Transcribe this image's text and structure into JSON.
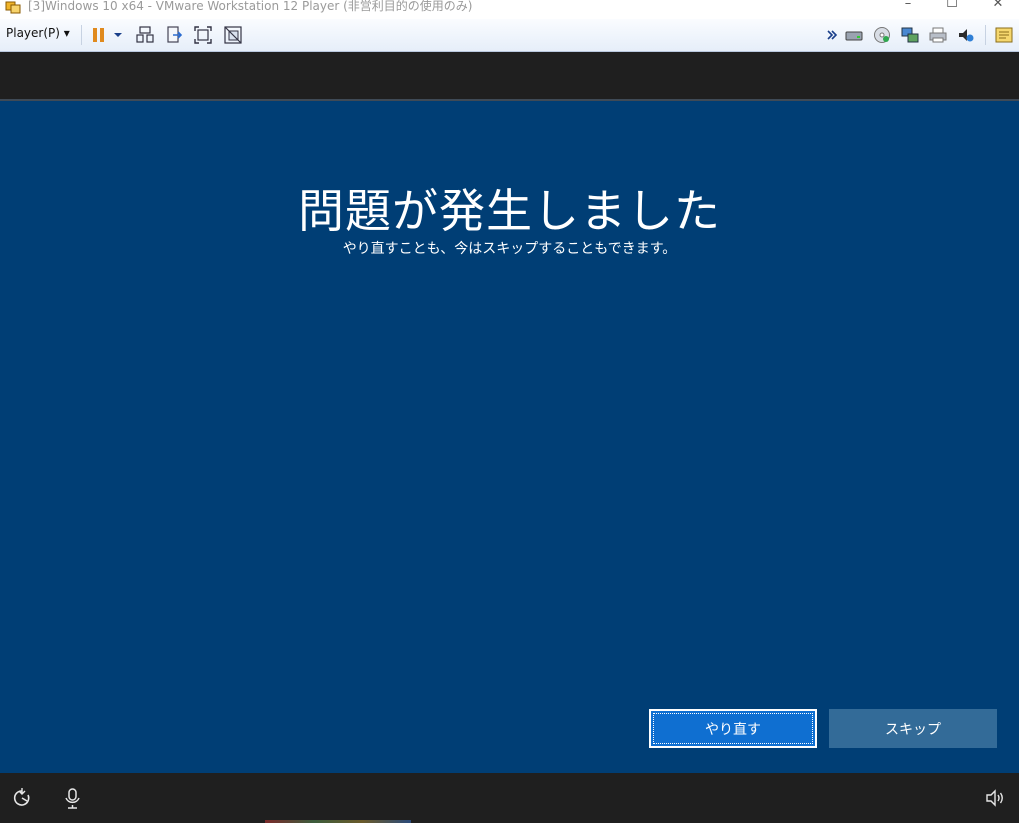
{
  "window": {
    "title": "[3]Windows 10 x64 - VMware Workstation 12 Player (非営利目的の使用のみ)",
    "minimize_glyph": "–",
    "maximize_glyph": "☐",
    "close_glyph": "✕"
  },
  "toolbar": {
    "player_menu_label": "Player(P) ▾",
    "left_icons": [
      "pause-icon",
      "dropdown-arrow-icon",
      "send-ctrl-alt-del-icon",
      "removable-devices-icon",
      "fullscreen-icon",
      "unity-icon"
    ],
    "right_icons": [
      "more-chevron-icon",
      "hard-disk-icon",
      "cd-dvd-icon",
      "network-adapter-icon",
      "printer-icon",
      "sound-card-icon",
      "message-log-icon"
    ]
  },
  "oobe": {
    "title": "問題が発生しました",
    "subtitle": "やり直すことも、今はスキップすることもできます。",
    "retry_label": "やり直す",
    "skip_label": "スキップ"
  },
  "bottombar": {
    "icons": [
      "ease-of-access-icon",
      "microphone-icon",
      "volume-icon"
    ]
  },
  "colors": {
    "oobe_background": "#003e75",
    "primary_button": "#0f6fd1",
    "secondary_button": "#336b98",
    "dark_band": "#1f1f1f"
  }
}
